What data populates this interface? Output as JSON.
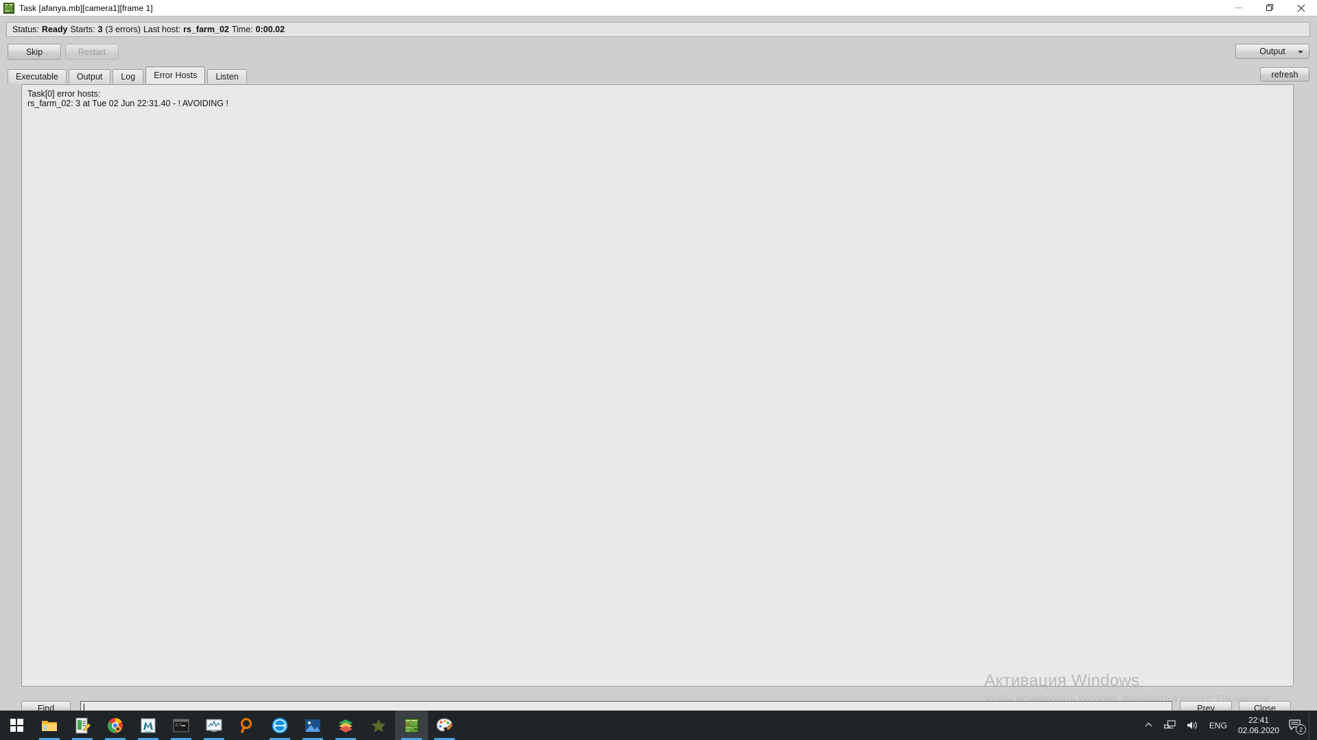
{
  "window": {
    "title": "Task [afanya.mb][camera1][frame 1]",
    "icon": "render-task-icon",
    "controls": {
      "minimize": "minimize-icon",
      "maximize": "restore-icon",
      "close": "close-icon"
    }
  },
  "status_bar": {
    "status_label": "Status:",
    "status_value": "Ready",
    "starts_label": "Starts:",
    "starts_value": "3",
    "errors_note": "(3 errors)",
    "last_host_label": "Last host:",
    "last_host_value": "rs_farm_02",
    "time_label": "Time:",
    "time_value": "0:00.02"
  },
  "toolbar": {
    "skip_label": "Skip",
    "restart_label": "Restart",
    "restart_disabled": true,
    "output_combo_value": "Output",
    "output_combo_options": [
      "Output"
    ],
    "refresh_label": "refresh"
  },
  "tabs": [
    {
      "label": "Executable",
      "active": false
    },
    {
      "label": "Output",
      "active": false
    },
    {
      "label": "Log",
      "active": false
    },
    {
      "label": "Error Hosts",
      "active": true
    },
    {
      "label": "Listen",
      "active": false
    }
  ],
  "content": {
    "lines": [
      "Task[0] error hosts:",
      "rs_farm_02: 3 at Tue 02 Jun 22:31.40 - ! AVOIDING !"
    ]
  },
  "watermark": {
    "line1": "Активация Windows",
    "line2": "Чтобы активировать Windows, перейдите в раздел \"Параметры\"."
  },
  "find_bar": {
    "find_label": "Find",
    "input_value": "",
    "input_placeholder": "",
    "prev_label": "Prev",
    "close_label": "Close"
  },
  "taskbar": {
    "start": "windows-start-icon",
    "items": [
      {
        "name": "file-explorer",
        "active": false,
        "running": true
      },
      {
        "name": "notepad-editor",
        "active": false,
        "running": true
      },
      {
        "name": "google-chrome",
        "active": false,
        "running": true
      },
      {
        "name": "autodesk-maya",
        "active": false,
        "running": true
      },
      {
        "name": "command-prompt",
        "active": false,
        "running": true
      },
      {
        "name": "system-monitor",
        "active": false,
        "running": true
      },
      {
        "name": "search-everything",
        "active": false,
        "running": false
      },
      {
        "name": "teamviewer",
        "active": false,
        "running": true
      },
      {
        "name": "photo-viewer",
        "active": false,
        "running": true
      },
      {
        "name": "books-library",
        "active": false,
        "running": true
      },
      {
        "name": "star-app",
        "active": false,
        "running": false
      },
      {
        "name": "render-task-manager",
        "active": true,
        "running": true
      },
      {
        "name": "paint-app",
        "active": false,
        "running": true
      }
    ],
    "tray": {
      "overflow": "chevron-up-icon",
      "network": "network-icon",
      "volume": "volume-icon",
      "language": "ENG",
      "time": "22:41",
      "date": "02.06.2020",
      "notifications": "notifications-icon",
      "notification_count": "2"
    }
  },
  "colors": {
    "window_bg": "#cfcfcf",
    "panel_bg": "#e9e9e9",
    "taskbar_bg": "#1f2427",
    "accent": "#4aa3e0",
    "border": "#9d9d9d"
  }
}
